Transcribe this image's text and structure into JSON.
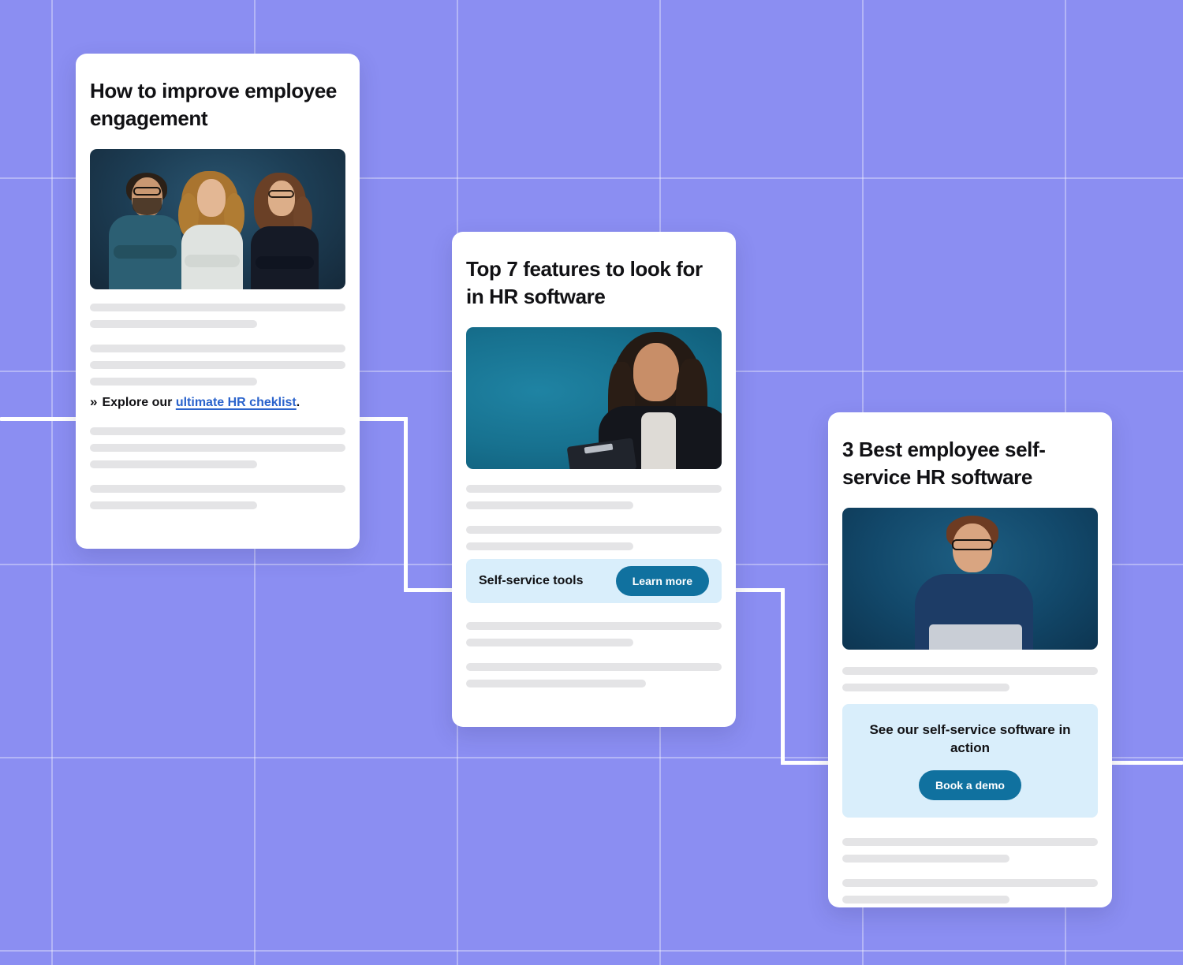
{
  "canvas": {
    "background_color": "#8b8ef2",
    "grid_line_color": "#ffffff",
    "connector_color": "#ffffff"
  },
  "theme": {
    "card_background": "#ffffff",
    "placeholder_bar_color": "#e4e4e6",
    "link_color": "#2a63cc",
    "cta_band_background": "#d9eefb",
    "cta_button_color": "#10719f",
    "cta_button_text_color": "#ffffff",
    "heading_color": "#111114"
  },
  "cards": [
    {
      "id": "card-1",
      "title": "How to improve employee engagement",
      "image": {
        "name": "team-photo",
        "alt": "Three smiling colleagues with arms crossed on a dark navy background"
      },
      "link_line": {
        "chevron": "»",
        "prefix": "Explore our ",
        "link_text": "ultimate HR cheklist",
        "suffix": "."
      }
    },
    {
      "id": "card-2",
      "title": "Top 7 features to look for in HR software",
      "image": {
        "name": "hr-professional-photo",
        "alt": "Businesswoman in a black blazer holding a clipboard on a teal background"
      },
      "cta_band": {
        "label": "Self-service tools",
        "button_label": "Learn more"
      }
    },
    {
      "id": "card-3",
      "title": "3 Best employee self-service HR software",
      "image": {
        "name": "employee-with-laptop-photo",
        "alt": "Man with glasses working on a laptop on a blue background"
      },
      "cta_block": {
        "title": "See our self-service software in action",
        "button_label": "Book a demo"
      }
    }
  ]
}
